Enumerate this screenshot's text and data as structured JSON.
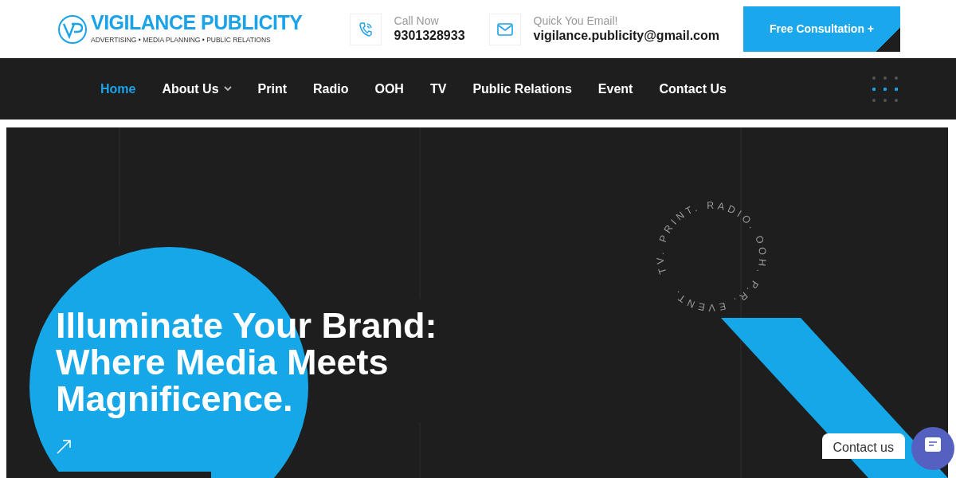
{
  "logo": {
    "title": "VIGILANCE PUBLICITY",
    "tagline": "ADVERTISING • MEDIA PLANNING • PUBLIC RELATIONS"
  },
  "contacts": [
    {
      "kind": "phone",
      "label": "Call Now",
      "value": "9301328933"
    },
    {
      "kind": "email",
      "label": "Quick You Email!",
      "value": "vigilance.publicity@gmail.com"
    }
  ],
  "cta_button": "Free Consultation +",
  "nav": [
    {
      "label": "Home",
      "selected": true,
      "dropdown": false
    },
    {
      "label": "About Us",
      "selected": false,
      "dropdown": true
    },
    {
      "label": "Print",
      "selected": false,
      "dropdown": false
    },
    {
      "label": "Radio",
      "selected": false,
      "dropdown": false
    },
    {
      "label": "OOH",
      "selected": false,
      "dropdown": false
    },
    {
      "label": "TV",
      "selected": false,
      "dropdown": false
    },
    {
      "label": "Public Relations",
      "selected": false,
      "dropdown": false
    },
    {
      "label": "Event",
      "selected": false,
      "dropdown": false
    },
    {
      "label": "Contact Us",
      "selected": false,
      "dropdown": false
    }
  ],
  "hero": {
    "headline": [
      "Illuminate Your Brand:",
      "Where Media Meets",
      "Magnificence."
    ],
    "rotating_text": "TV. PRINT. RADIO. OOH. P.R. EVENT."
  },
  "chat_widget": {
    "label": "Contact us"
  }
}
